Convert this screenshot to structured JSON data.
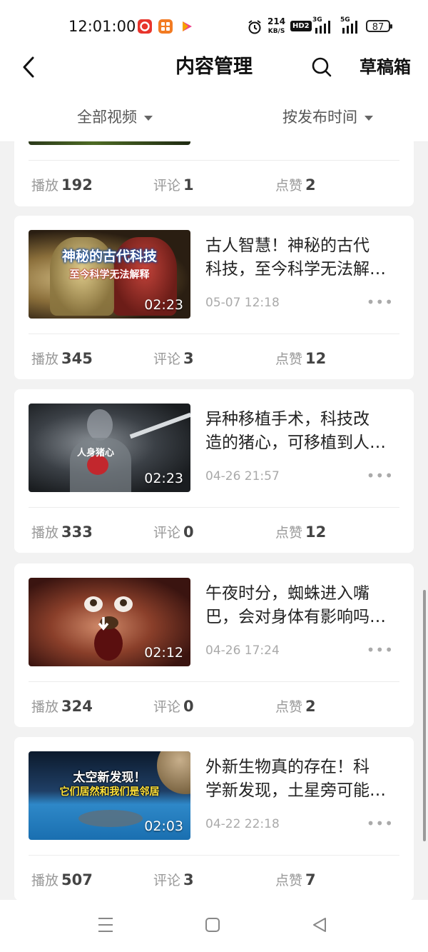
{
  "status_bar": {
    "time": "12:01:00",
    "net_speed": "214",
    "net_unit": "KB/S",
    "hd_label": "HD2",
    "sig1_label": "3G",
    "sig2_label": "5G",
    "battery": "87",
    "icons": [
      "app-red-icon",
      "app-orange-icon",
      "app-play-icon",
      "alarm-icon",
      "signal-icon",
      "battery-icon"
    ]
  },
  "header": {
    "title": "内容管理",
    "drafts_label": "草稿箱",
    "back_icon": "chevron-left-icon",
    "search_icon": "search-icon"
  },
  "filters": {
    "category": "全部视频",
    "sort": "按发布时间"
  },
  "stat_labels": {
    "plays": "播放",
    "comments": "评论",
    "likes": "点赞"
  },
  "more_glyph": "•••",
  "partial_card": {
    "plays": "192",
    "comments": "1",
    "likes": "2"
  },
  "videos": [
    {
      "title_line1": "古人智慧！神秘的古代",
      "title_line2": "科技，至今科学无法解…",
      "date": "05-07 12:18",
      "duration": "02:23",
      "thumb_caption1": "神秘的古代科技",
      "thumb_caption2": "至今科学无法解释",
      "plays": "345",
      "comments": "3",
      "likes": "12"
    },
    {
      "title_line1": "异种移植手术，科技改",
      "title_line2": "造的猪心，可移植到人…",
      "date": "04-26 21:57",
      "duration": "02:23",
      "thumb_caption1": "人身猪心",
      "thumb_caption2": "",
      "plays": "333",
      "comments": "0",
      "likes": "12"
    },
    {
      "title_line1": "午夜时分，蜘蛛进入嘴",
      "title_line2": "巴，会对身体有影响吗…",
      "date": "04-26 17:24",
      "duration": "02:12",
      "thumb_caption1": "",
      "thumb_caption2": "",
      "plays": "324",
      "comments": "0",
      "likes": "2"
    },
    {
      "title_line1": "外新生物真的存在！科",
      "title_line2": "学新发现，土星旁可能…",
      "date": "04-22 22:18",
      "duration": "02:03",
      "thumb_caption1": "太空新发现！",
      "thumb_caption2": "它们居然和我们是邻居",
      "plays": "507",
      "comments": "3",
      "likes": "7"
    }
  ],
  "nav": {
    "icons": [
      "menu-icon",
      "home-square-icon",
      "back-triangle-icon"
    ]
  }
}
